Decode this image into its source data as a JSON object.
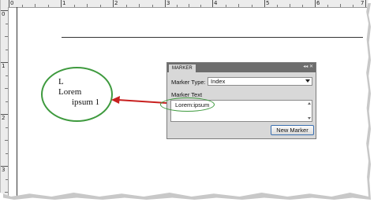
{
  "rulers": {
    "top_ticks": [
      "0",
      "1",
      "2",
      "3",
      "4",
      "5",
      "6",
      "7"
    ],
    "left_ticks": [
      "0",
      "1",
      "2",
      "3"
    ]
  },
  "document": {
    "marker_line_1": "L",
    "marker_line_2": "Lorem",
    "marker_line_3": "ipsum 1"
  },
  "annotation": {
    "circle_color": "#3e9a3e",
    "arrow_color": "#c8201f"
  },
  "marker_panel": {
    "tab_label": "MARKER",
    "header_controls": "◂◂ ✕",
    "marker_type_label": "Marker Type:",
    "marker_type_value": "Index",
    "marker_text_label": "Marker Text",
    "marker_text_value": "Lorem:ipsum",
    "new_marker_button": "New Marker"
  }
}
